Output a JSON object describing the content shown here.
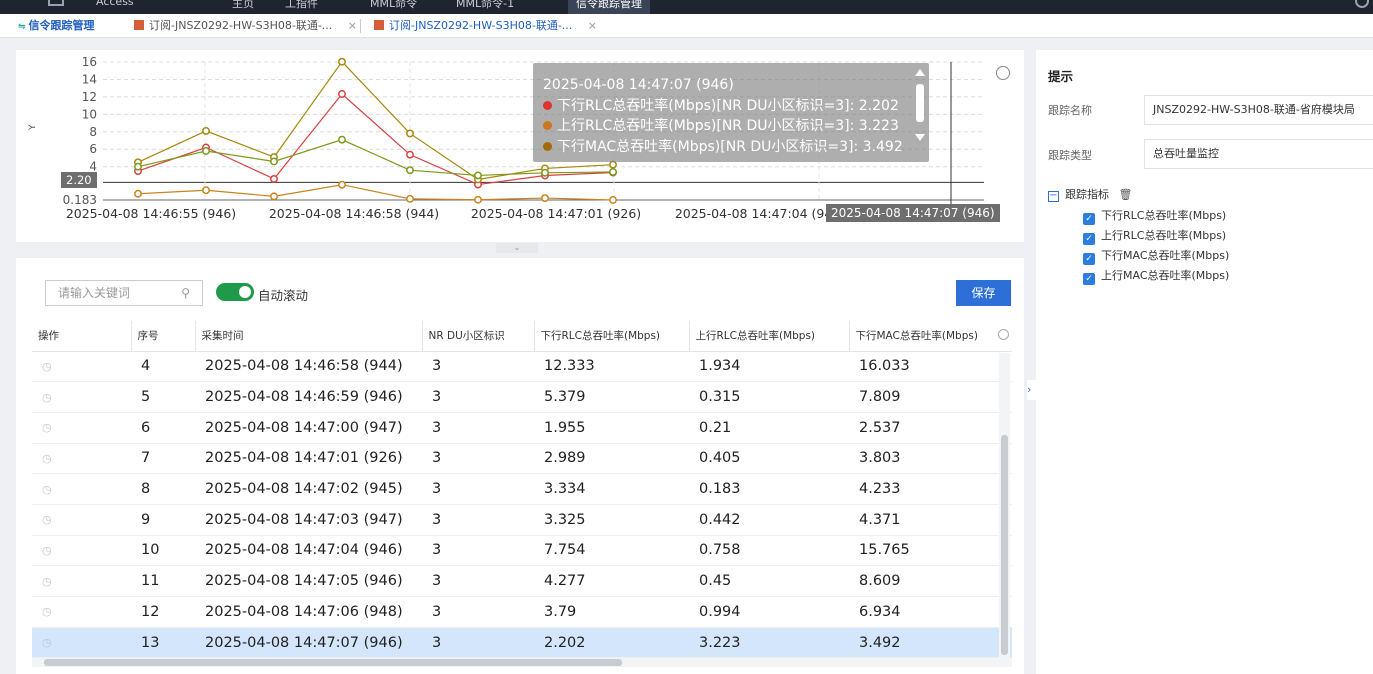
{
  "topbar": {
    "tabs": [
      "Access",
      "主页",
      "工指件",
      "MML命令",
      "MML命令-1",
      "信令跟踪管理"
    ]
  },
  "tabs": [
    {
      "label": "信令跟踪管理"
    },
    {
      "label": "订阅-JNSZ0292-HW-S3H08-联通-..."
    },
    {
      "label": "订阅-JNSZ0292-HW-S3H08-联通-..."
    }
  ],
  "chart_data": {
    "type": "line",
    "x": [
      "2025-04-08 14:46:55 (946)",
      "2025-04-08 14:46:58 (944)",
      "2025-04-08 14:47:01 (926)",
      "2025-04-08 14:47:04 (946)",
      "2025-04-08 14:47:07 (946)"
    ],
    "ylim": [
      0.183,
      16
    ],
    "yticks": [
      "16",
      "14",
      "12",
      "10",
      "8",
      "6",
      "4",
      "0.183"
    ],
    "ylabel": "Y",
    "crosshair_value": "2.20",
    "series": [
      {
        "name": "下行RLC总吞吐率(Mbps)[NR DU小区标识=3]",
        "color": "#d94040",
        "values": [
          3.5,
          6.2,
          2.6,
          12.333,
          5.379,
          1.955,
          2.989,
          3.334
        ]
      },
      {
        "name": "上行RLC总吞吐率(Mbps)[NR DU小区标识=3]",
        "color": "#c8841e",
        "values": [
          0.9,
          1.3,
          0.6,
          1.934,
          0.315,
          0.21,
          0.405,
          0.183
        ]
      },
      {
        "name": "下行MAC总吞吐率(Mbps)[NR DU小区标识=3]",
        "color": "#a7870b",
        "values": [
          4.5,
          8.1,
          5.1,
          16.033,
          7.809,
          2.537,
          3.803,
          4.233
        ]
      },
      {
        "name": "上行MAC总吞吐率(Mbps)",
        "color": "#7a9a1a",
        "values": [
          4.0,
          5.8,
          4.6,
          7.1,
          3.6,
          3.0,
          3.3,
          3.4
        ]
      }
    ]
  },
  "tooltip": {
    "title": "2025-04-08 14:47:07 (946)",
    "rows": [
      {
        "text": "下行RLC总吞吐率(Mbps)[NR DU小区标识=3]: 2.202",
        "color": "#d94040"
      },
      {
        "text": "上行RLC总吞吐率(Mbps)[NR DU小区标识=3]: 3.223",
        "color": "#c8841e"
      },
      {
        "text": "下行MAC总吞吐率(Mbps)[NR DU小区标识=3]: 3.492",
        "color": "#a7870b"
      }
    ],
    "x_badge": "2025-04-08 14:47:07 (946)"
  },
  "toolbar": {
    "search_placeholder": "请输入关键词",
    "auto_scroll_label": "自动滚动",
    "save_label": "保存"
  },
  "table": {
    "headers": [
      "操作",
      "序号",
      "采集时间",
      "NR DU小区标识",
      "下行RLC总吞吐率(Mbps)",
      "上行RLC总吞吐率(Mbps)",
      "下行MAC总吞吐率(Mbps)"
    ],
    "rows": [
      [
        "4",
        "2025-04-08 14:46:58 (944)",
        "3",
        "12.333",
        "1.934",
        "16.033"
      ],
      [
        "5",
        "2025-04-08 14:46:59 (946)",
        "3",
        "5.379",
        "0.315",
        "7.809"
      ],
      [
        "6",
        "2025-04-08 14:47:00 (947)",
        "3",
        "1.955",
        "0.21",
        "2.537"
      ],
      [
        "7",
        "2025-04-08 14:47:01 (926)",
        "3",
        "2.989",
        "0.405",
        "3.803"
      ],
      [
        "8",
        "2025-04-08 14:47:02 (945)",
        "3",
        "3.334",
        "0.183",
        "4.233"
      ],
      [
        "9",
        "2025-04-08 14:47:03 (947)",
        "3",
        "3.325",
        "0.442",
        "4.371"
      ],
      [
        "10",
        "2025-04-08 14:47:04 (946)",
        "3",
        "7.754",
        "0.758",
        "15.765"
      ],
      [
        "11",
        "2025-04-08 14:47:05 (946)",
        "3",
        "4.277",
        "0.45",
        "8.609"
      ],
      [
        "12",
        "2025-04-08 14:47:06 (948)",
        "3",
        "3.79",
        "0.994",
        "6.934"
      ],
      [
        "13",
        "2025-04-08 14:47:07 (946)",
        "3",
        "2.202",
        "3.223",
        "3.492"
      ]
    ]
  },
  "panel": {
    "title": "提示",
    "name_label": "跟踪名称",
    "name_value": "JNSZ0292-HW-S3H08-联通-省府模块局",
    "type_label": "跟踪类型",
    "type_value": "总吞吐量监控",
    "metrics_label": "跟踪指标",
    "metrics": [
      "下行RLC总吞吐率(Mbps)",
      "上行RLC总吞吐率(Mbps)",
      "下行MAC总吞吐率(Mbps)",
      "上行MAC总吞吐率(Mbps)"
    ]
  }
}
